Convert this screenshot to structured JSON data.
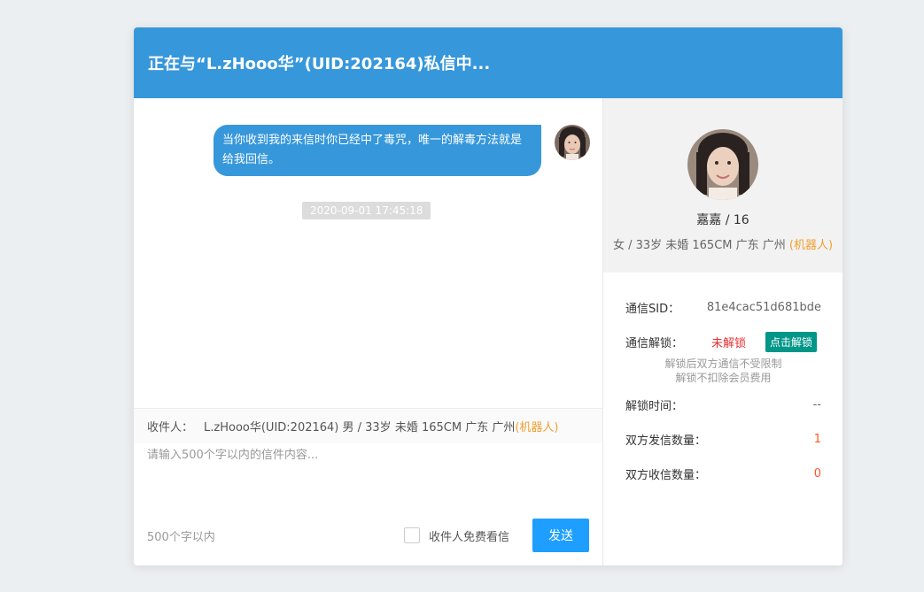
{
  "dialog": {
    "title": "正在与“L.zHooo华”(UID:202164)私信中..."
  },
  "chat": {
    "messages": [
      {
        "text": "当你收到我的来信时你已经中了毒咒，唯一的解毒方法就是给我回信。",
        "timestamp": "2020-09-01 17:45:18"
      }
    ]
  },
  "recipient": {
    "label": "收件人：",
    "name": "L.zHooo华",
    "details": " (UID:202164) 男 / 33岁 未婚 165CM 广东 广州 ",
    "tag": "(机器人)"
  },
  "compose": {
    "placeholder": "请输入500个字以内的信件内容..."
  },
  "footer": {
    "char_limit": "500个字以内",
    "free_read_label": "收件人免费看信",
    "send_label": "发送"
  },
  "profile": {
    "name": "嘉嘉 / 16",
    "info": "女 / 33岁 未婚 165CM 广东 广州 ",
    "tag": "(机器人)"
  },
  "stats": {
    "sid_label": "通信SID：",
    "sid_value": "81e4cac51d681bde",
    "unlock_label": "通信解锁：",
    "unlock_status": "未解锁",
    "unlock_button": "点击解锁",
    "unlock_note_1": "解锁后双方通信不受限制",
    "unlock_note_2": "解锁不扣除会员费用",
    "unlock_time_label": "解锁时间：",
    "unlock_time_value": "--",
    "sent_label": "双方发信数量：",
    "sent_value": "1",
    "received_label": "双方收信数量：",
    "received_value": "0"
  },
  "colors": {
    "header": "#3797db",
    "bubble": "#3797db",
    "send": "#1e9fff",
    "unlock": "#009688",
    "robot_tag": "#f0a030",
    "count": "#ff5722"
  }
}
